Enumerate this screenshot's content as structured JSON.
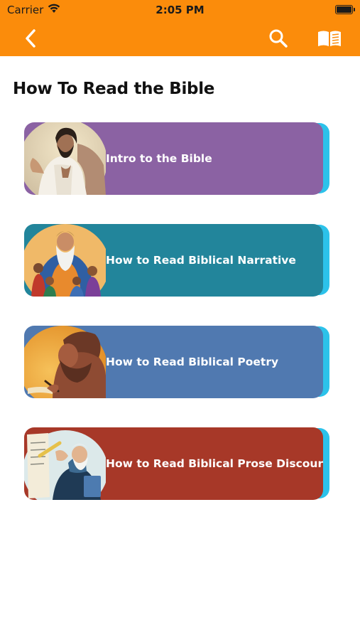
{
  "status_bar": {
    "carrier": "Carrier",
    "time": "2:05 PM",
    "wifi_icon": "wifi-icon",
    "battery_icon": "battery-icon"
  },
  "nav": {
    "background": "#fb8c0b",
    "back_icon": "chevron-left-icon",
    "search_icon": "search-icon",
    "book_icon": "open-book-icon"
  },
  "page": {
    "title": "How To Read the Bible"
  },
  "cards": [
    {
      "label": "Intro to the Bible",
      "color": "#8b62a3"
    },
    {
      "label": "How to Read Biblical Narrative",
      "color": "#22859b"
    },
    {
      "label": "How to Read Biblical Poetry",
      "color": "#5079b0"
    },
    {
      "label": "How to Read Biblical Prose Discourse",
      "color": "#a73828"
    }
  ],
  "card_accent": "#2cc2ea"
}
